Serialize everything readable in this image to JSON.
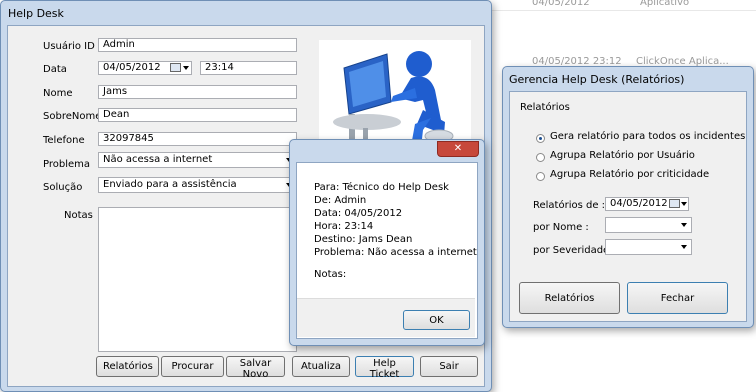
{
  "background": {
    "rows": [
      {
        "date": "04/05/2012",
        "text": "Aplicativo"
      },
      {
        "date": "04/05/2012 23:12",
        "text": "ClickOnce Aplica..."
      }
    ]
  },
  "help_desk": {
    "title": "Help Desk",
    "labels": {
      "usuario_id": "Usuário ID",
      "data": "Data",
      "nome": "Nome",
      "sobrenome": "SobreNome",
      "telefone": "Telefone",
      "problema": "Problema",
      "solucao": "Solução",
      "notas": "Notas"
    },
    "values": {
      "usuario_id": "Admin",
      "data": "04/05/2012",
      "hora": "23:14",
      "nome": "Jams",
      "sobrenome": "Dean",
      "telefone": "32097845",
      "problema": "Não acessa a internet",
      "solucao": "Enviado para a assistência",
      "notas": ""
    },
    "buttons": {
      "relatorios": "Relatórios",
      "procurar": "Procurar",
      "salvar_novo": "Salvar Novo",
      "atualiza": "Atualiza",
      "help_ticket": "Help Ticket",
      "sair": "Sair"
    }
  },
  "ticket_dialog": {
    "lines": {
      "para": "Para: Técnico do Help Desk",
      "de": "De: Admin",
      "data": "Data: 04/05/2012",
      "hora": "Hora: 23:14",
      "destino": "Destino: Jams Dean",
      "problema": "Problema: Não acessa a internet",
      "notas": "Notas:"
    },
    "ok_label": "OK",
    "close_glyph": "✕"
  },
  "reports": {
    "title": "Gerencia Help Desk (Relatórios)",
    "group_label": "Relatórios",
    "radios": [
      {
        "label": "Gera relatório para todos os incidentes",
        "checked": true
      },
      {
        "label": "Agrupa Relatório por Usuário",
        "checked": false
      },
      {
        "label": "Agrupa Relatório por criticidade",
        "checked": false
      }
    ],
    "labels": {
      "relatorios_de": "Relatórios de :",
      "por_nome": "por Nome :",
      "por_severidade": "por Severidade :"
    },
    "values": {
      "relatorios_de": "04/05/2012",
      "por_nome": "",
      "por_severidade": ""
    },
    "buttons": {
      "relatorios": "Relatórios",
      "fechar": "Fechar"
    }
  }
}
